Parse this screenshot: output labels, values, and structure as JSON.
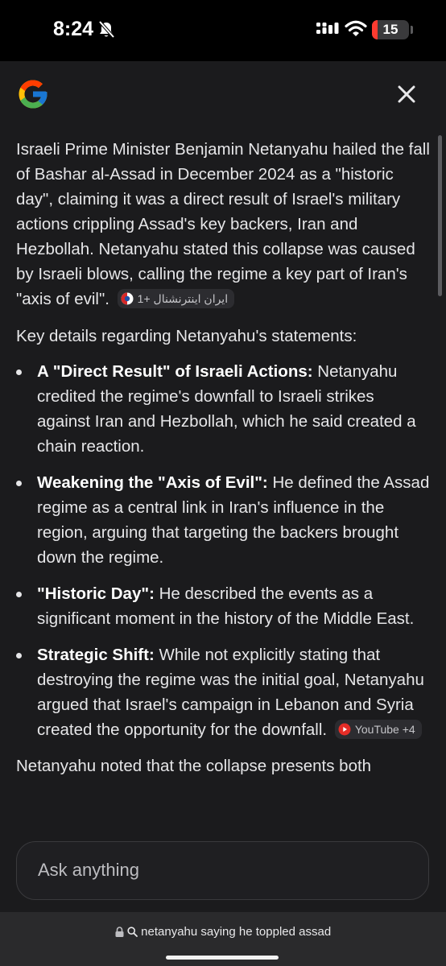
{
  "status_bar": {
    "time": "8:24",
    "battery_level": "15",
    "battery_fraction": 0.15,
    "icons": [
      "bell-slash-icon",
      "cellular-signal-icon",
      "wifi-icon",
      "battery-icon"
    ]
  },
  "header": {
    "logo": "google-g-logo",
    "close_icon": "close-icon"
  },
  "article": {
    "intro_text": "Israeli Prime Minister Benjamin Netanyahu hailed the fall of Bashar al-Assad in December 2024 as a \"historic day\", claiming it was a direct result of Israel's military actions crippling Assad's key backers, Iran and Hezbollah. Netanyahu stated this collapse was caused by Israeli blows, calling the regime a key part of Iran's \"axis of evil\".",
    "intro_chip": "ایران اینترنشنال +1",
    "key_details_heading": "Key details regarding Netanyahu's statements:",
    "items": [
      {
        "title": "A \"Direct Result\" of Israeli Actions:",
        "text": "Netanyahu credited the regime's downfall to Israeli strikes against Iran and Hezbollah, which he said created a chain reaction."
      },
      {
        "title": "Weakening the \"Axis of Evil\":",
        "text": "He defined the Assad regime as a central link in Iran's influence in the region, arguing that targeting the backers brought down the regime."
      },
      {
        "title": "\"Historic Day\":",
        "text": "He described the events as a significant moment in the history of the Middle East."
      },
      {
        "title": "Strategic Shift:",
        "text": "While not explicitly stating that destroying the regime was the initial goal, Netanyahu argued that Israel's campaign in Lebanon and Syria created the opportunity for the downfall.",
        "chip": "YouTube +4"
      }
    ],
    "trailing_text": "Netanyahu noted that the collapse presents both"
  },
  "ask": {
    "placeholder": "Ask anything"
  },
  "browser": {
    "url_text": "netanyahu saying he toppled assad"
  },
  "colors": {
    "background": "#1b1b1d",
    "text": "#e6e6e8",
    "chip_bg": "#2c2c30",
    "battery_low": "#ff3b30",
    "youtube_red": "#e52d27"
  }
}
